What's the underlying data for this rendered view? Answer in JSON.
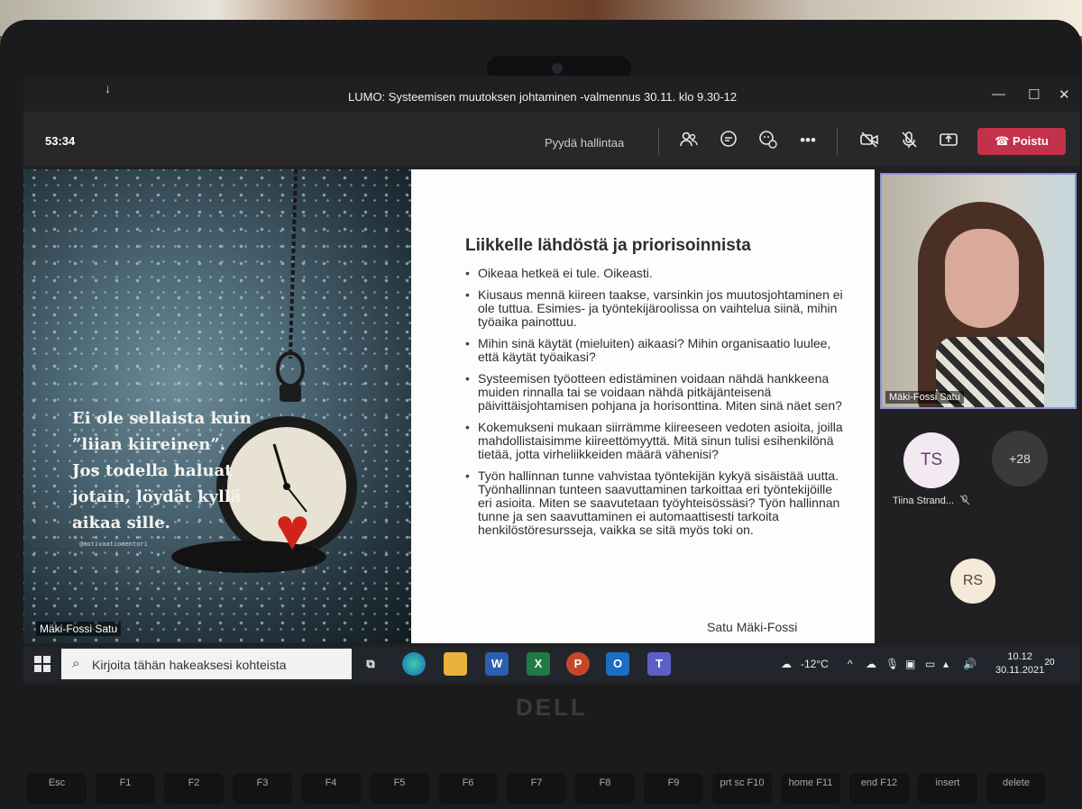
{
  "window": {
    "title": "LUMO: Systeemisen muutoksen johtaminen -valmennus 30.11. klo 9.30-12",
    "controls": {
      "minimize": "—",
      "maximize": "☐",
      "close": "✕"
    }
  },
  "toolbar": {
    "timer": "53:34",
    "request_control": "Pyydä hallintaa",
    "leave": "Poistu"
  },
  "slide": {
    "quote": "Ei ole sellaista kuin ”liian kiireinen”. Jos todella haluat jotain, löydät kyllä aikaa sille.",
    "handle": "@motivaatiomentori",
    "title": "Liikkelle lähdöstä ja priorisoinnista",
    "bullets": [
      "Oikeaa hetkeä ei tule. Oikeasti.",
      "Kiusaus mennä kiireen taakse, varsinkin jos muutosjohtaminen ei ole tuttua. Esimies- ja työntekijäroolissa on vaihtelua siinä, mihin työaika painottuu.",
      "Mihin sinä käytät (mieluiten) aikaasi? Mihin organisaatio luulee, että käytät työaikasi?",
      "Systeemisen työotteen edistäminen voidaan nähdä hankkeena muiden rinnalla tai se voidaan nähdä pitkäjänteisenä päivittäisjohtamisen pohjana ja horisonttina. Miten sinä näet sen?",
      "Kokemukseni mukaan siirrämme kiireeseen vedoten asioita, joilla mahdollistaisimme kiireettömyyttä. Mitä sinun tulisi esihenkilönä tietää, jotta virheliikkeiden määrä vähenisi?",
      "Työn hallinnan tunne vahvistaa työntekijän kykyä sisäistää uutta. Työnhallinnan tunteen saavuttaminen tarkoittaa eri työntekijöille eri asioita. Miten se saavutetaan työyhteisössäsi? Työn hallinnan tunne ja sen saavuttaminen ei automaattisesti tarkoita henkilöstöresursseja, vaikka se sitä myös toki on."
    ],
    "author": "Satu Mäki-Fossi",
    "presenter_label": "Mäki-Fossi Satu"
  },
  "participants": {
    "video_name": "Mäki-Fossi Satu",
    "avatar1_initials": "TS",
    "avatar1_name": "Tiina Strand...",
    "more_count": "+28",
    "avatar2_initials": "RS"
  },
  "taskbar": {
    "search_placeholder": "Kirjoita tähän hakeaksesi kohteista",
    "temperature": "-12°C",
    "time": "10.12",
    "date": "30.11.2021",
    "notifications": "20"
  },
  "laptop": {
    "brand": "DELL",
    "keys": [
      "Esc",
      "F1",
      "F2",
      "F3",
      "F4",
      "F5",
      "F6",
      "F7",
      "F8",
      "F9",
      "prt sc F10",
      "home F11",
      "end F12",
      "insert",
      "delete"
    ]
  },
  "colors": {
    "leave_button": "#c4314b",
    "active_border": "#8b93d6",
    "taskbar": "#22262c"
  }
}
